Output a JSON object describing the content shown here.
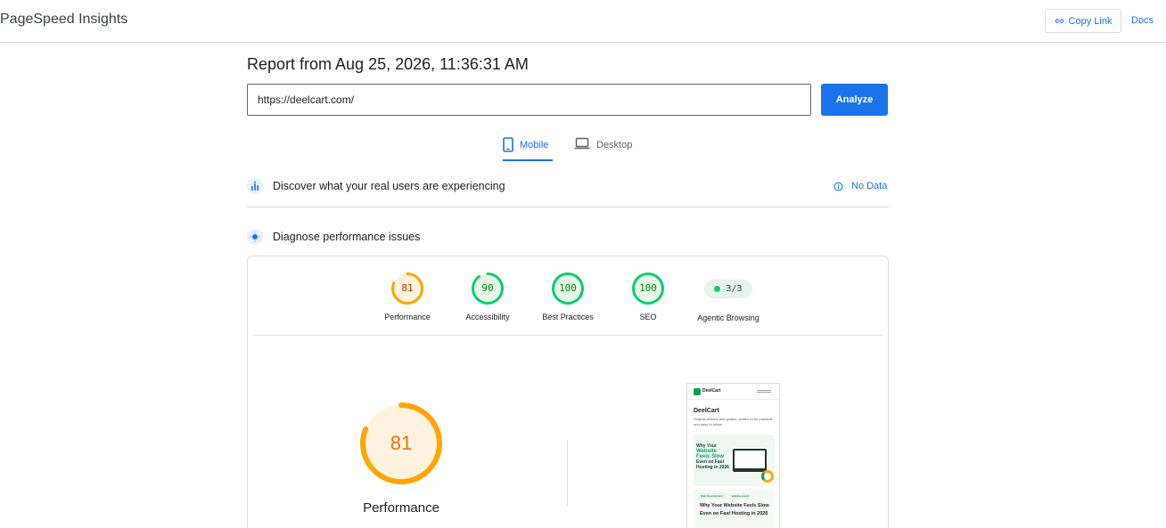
{
  "header": {
    "app_title": "PageSpeed Insights",
    "copy_link_label": "Copy Link",
    "docs_label": "Docs"
  },
  "report": {
    "title": "Report from Aug 25, 2026, 11:36:31 AM",
    "url_value": "https://deelcart.com/",
    "analyze_label": "Analyze"
  },
  "tabs": [
    {
      "label": "Mobile",
      "active": true,
      "icon": "smartphone-icon"
    },
    {
      "label": "Desktop",
      "active": false,
      "icon": "laptop-icon"
    }
  ],
  "field_data": {
    "label": "Discover what your real users are experiencing",
    "status_label": "No Data",
    "icon": "users-chart-icon"
  },
  "lab_data": {
    "label": "Diagnose performance issues",
    "icon": "lighthouse-icon"
  },
  "scores": [
    {
      "label": "Performance",
      "value": "81",
      "fraction": 0.81,
      "color": "#ffa400",
      "track": "#fff3e0",
      "text_color": "#c33300"
    },
    {
      "label": "Accessibility",
      "value": "90",
      "fraction": 0.9,
      "color": "#0cce6b",
      "track": "#e6f4ea",
      "text_color": "#008800"
    },
    {
      "label": "Best Practices",
      "value": "100",
      "fraction": 1.0,
      "color": "#0cce6b",
      "track": "#e6f4ea",
      "text_color": "#008800"
    },
    {
      "label": "SEO",
      "value": "100",
      "fraction": 1.0,
      "color": "#0cce6b",
      "track": "#e6f4ea",
      "text_color": "#008800"
    }
  ],
  "agentic": {
    "label": "Agentic Browsing",
    "value": "3/3",
    "color": "#0cce6b"
  },
  "main_gauge": {
    "value": "81",
    "fraction": 0.81,
    "label": "Performance",
    "color": "#ffa400",
    "track": "#fff3e0"
  },
  "screenshot": {
    "brand_small": "DeelCart",
    "brand": "DeelCart",
    "tagline": "Original articles and guides, written to be practical and easy to follow.",
    "hero_line1": "Why Your",
    "hero_line2": "Website",
    "hero_line3": "Feels Slow",
    "hero_line4": "Even on Fast Hosting in 2026",
    "tag1": "Web Development",
    "tag2": "website speed",
    "post_title": "Why Your Website Feels Slow Even on Fast Hosting in 2026"
  }
}
